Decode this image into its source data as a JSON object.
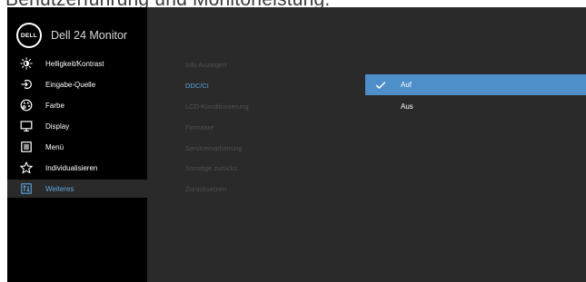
{
  "caption": "Benutzerführung und Monitorleistung.",
  "header": {
    "logo_text": "DELL",
    "title": "Dell 24 Monitor"
  },
  "sidebar": {
    "items": [
      {
        "label": "Helligkeit/Kontrast",
        "icon": "brightness-icon"
      },
      {
        "label": "Eingabe-Quelle",
        "icon": "input-source-icon"
      },
      {
        "label": "Farbe",
        "icon": "color-palette-icon"
      },
      {
        "label": "Display",
        "icon": "display-icon"
      },
      {
        "label": "Menü",
        "icon": "menu-icon"
      },
      {
        "label": "Individualisieren",
        "icon": "star-icon"
      },
      {
        "label": "Weiteres",
        "icon": "other-settings-icon",
        "active": true
      }
    ]
  },
  "submenu": {
    "items": [
      {
        "label": "Info Anzeigen"
      },
      {
        "label": "DDC/CI",
        "selected": true
      },
      {
        "label": "LCD-Konditionierung"
      },
      {
        "label": "Firmware"
      },
      {
        "label": "Servicemarkierung"
      },
      {
        "label": "Sonstige zurücks."
      },
      {
        "label": "Zurücksetzen"
      }
    ]
  },
  "options": {
    "items": [
      {
        "label": "Auf",
        "selected": true,
        "icon": "checkmark-icon"
      },
      {
        "label": "Aus"
      }
    ]
  },
  "colors": {
    "background": "#2a2a2a",
    "sidebar": "#000000",
    "accent_text": "#5aa5dc",
    "selected_option": "#4f8fc9",
    "dim_text": "#505050"
  }
}
